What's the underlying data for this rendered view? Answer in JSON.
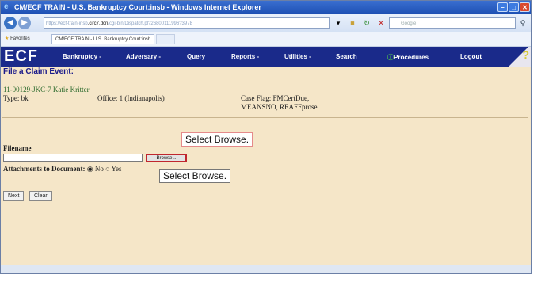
{
  "window": {
    "title": "CM/ECF TRAIN - U.S. Bankruptcy Court:insb - Windows Internet Explorer",
    "controls": [
      "minimize-icon",
      "maximize-icon",
      "close-icon"
    ]
  },
  "address_bar": {
    "url_prefix": "https://ecf-train-insb",
    "url_bold": ".circ7.dcn",
    "url_suffix": "/cgi-bin/Dispatch.pl?26800111996?3978",
    "search_placeholder": "Google"
  },
  "favorites_bar": {
    "favorites_label": "Favorites",
    "tab_title": "CM/ECF TRAIN - U.S. Bankruptcy Court:insb"
  },
  "ecf_nav": {
    "logo": "ECF",
    "items": [
      "Bankruptcy -",
      "Adversary -",
      "Query",
      "Reports -",
      "Utilities -",
      "Search",
      "Procedures",
      "Logout"
    ],
    "procedures_icon": "info-icon",
    "help_icon": "question-mark-icon"
  },
  "page": {
    "title": "File a Claim Event:",
    "case_link": "11-00129-JKC-7 Katie Kritter",
    "type": "Type: bk",
    "office": "Office: 1 (Indianapolis)",
    "case_flag_line1": "Case Flag: FMCertDue,",
    "case_flag_line2": "MEANSNO, REAFFprose"
  },
  "form": {
    "filename_label": "Filename",
    "filename_value": "",
    "browse_label": "Browse...",
    "attachments_label": "Attachments to Document:",
    "attach_no": "No",
    "attach_yes": "Yes",
    "attach_selected": "No",
    "next_label": "Next",
    "clear_label": "Clear"
  },
  "callouts": {
    "top": "Select Browse.",
    "bottom": "Select Browse."
  },
  "colors": {
    "page_background": "#f5e6c8",
    "ecf_nav": "#1a2a8a",
    "highlight": "#c0262e"
  }
}
